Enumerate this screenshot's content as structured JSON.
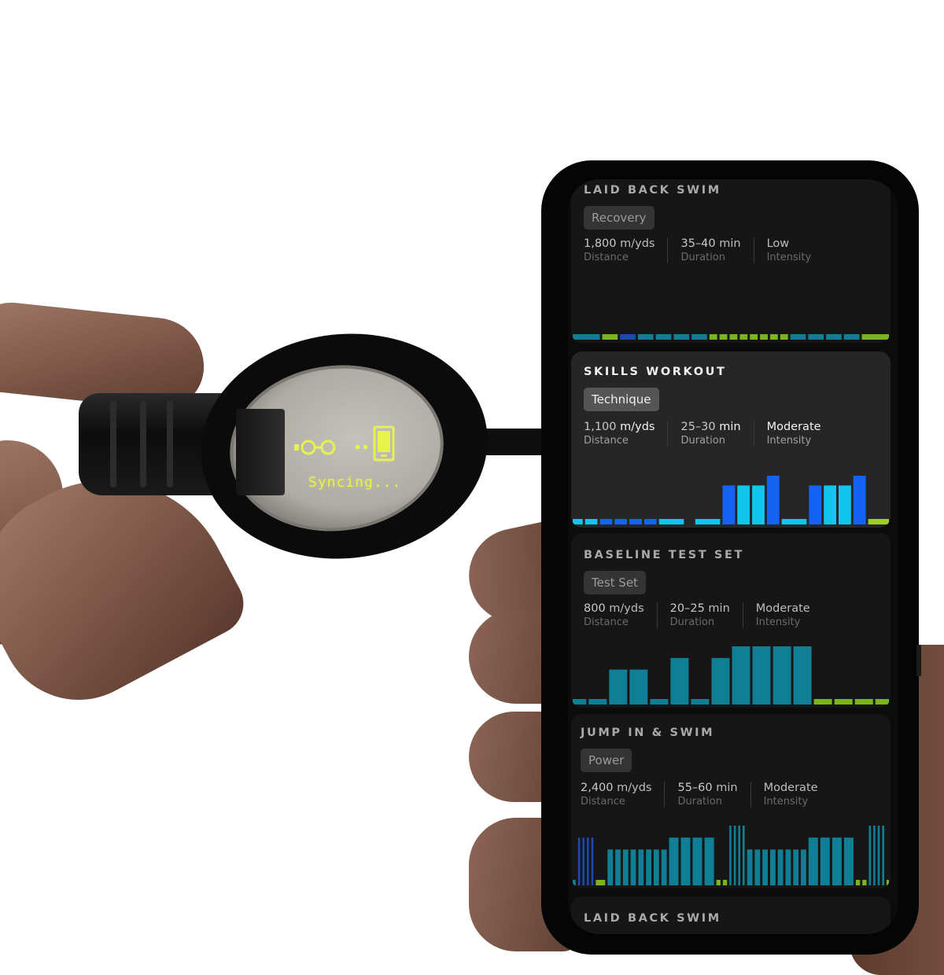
{
  "goggle": {
    "hud_status": "Syncing...",
    "hud_color": "#e8f24c"
  },
  "colors": {
    "teal": "#0f7f96",
    "blue_dark": "#1a49b3",
    "blue": "#1463f5",
    "cyan": "#10c6ec",
    "green": "#7ab51d",
    "green_bright": "#9ed11c"
  },
  "workouts": [
    {
      "title": "LAID BACK SWIM",
      "tag": "Recovery",
      "distance_value": "1,800",
      "distance_unit": "m/yds",
      "distance_label": "Distance",
      "duration_value": "35–40",
      "duration_unit": "min",
      "duration_label": "Duration",
      "intensity_value": "Low",
      "intensity_label": "Intensity",
      "selected": false,
      "chart_data": {
        "type": "bar",
        "description": "workout interval profile; width = relative duration, height = relative intensity level (1-5)",
        "segments": [
          {
            "w": 3.5,
            "h": 1,
            "c": "teal"
          },
          {
            "w": 2,
            "h": 1,
            "c": "green"
          },
          {
            "w": 2,
            "h": 1,
            "c": "blue_dark"
          },
          {
            "w": 2,
            "h": 1,
            "c": "teal"
          },
          {
            "w": 2,
            "h": 1,
            "c": "teal"
          },
          {
            "w": 2,
            "h": 1,
            "c": "teal"
          },
          {
            "w": 2,
            "h": 1,
            "c": "teal"
          },
          {
            "w": 1,
            "h": 1,
            "c": "green"
          },
          {
            "w": 1,
            "h": 1,
            "c": "green"
          },
          {
            "w": 1,
            "h": 1,
            "c": "green"
          },
          {
            "w": 1,
            "h": 1,
            "c": "green"
          },
          {
            "w": 1,
            "h": 1,
            "c": "green"
          },
          {
            "w": 1,
            "h": 1,
            "c": "green"
          },
          {
            "w": 1,
            "h": 1,
            "c": "green"
          },
          {
            "w": 1,
            "h": 1,
            "c": "green"
          },
          {
            "w": 2,
            "h": 1,
            "c": "teal"
          },
          {
            "w": 2,
            "h": 1,
            "c": "teal"
          },
          {
            "w": 2,
            "h": 1,
            "c": "teal"
          },
          {
            "w": 2,
            "h": 1,
            "c": "teal"
          },
          {
            "w": 3.5,
            "h": 1,
            "c": "green"
          }
        ]
      }
    },
    {
      "title": "SKILLS WORKOUT",
      "tag": "Technique",
      "distance_value": "1,100",
      "distance_unit": "m/yds",
      "distance_label": "Distance",
      "duration_value": "25–30",
      "duration_unit": "min",
      "duration_label": "Duration",
      "intensity_value": "Moderate",
      "intensity_label": "Intensity",
      "selected": true,
      "chart_data": {
        "type": "bar",
        "description": "workout interval profile; width = relative duration, height = relative intensity level (1-5)",
        "segments": [
          {
            "w": 1.2,
            "h": 1,
            "c": "cyan"
          },
          {
            "w": 1.5,
            "h": 1,
            "c": "cyan"
          },
          {
            "w": 1.5,
            "h": 1,
            "c": "blue"
          },
          {
            "w": 1.5,
            "h": 1,
            "c": "blue"
          },
          {
            "w": 1.5,
            "h": 1,
            "c": "blue"
          },
          {
            "w": 1.5,
            "h": 1,
            "c": "blue"
          },
          {
            "w": 3,
            "h": 1,
            "c": "cyan"
          },
          {
            "w": 0.8,
            "h": 0,
            "c": "cyan"
          },
          {
            "w": 3,
            "h": 1,
            "c": "cyan"
          },
          {
            "w": 1.5,
            "h": 4,
            "c": "blue"
          },
          {
            "w": 1.5,
            "h": 4,
            "c": "cyan"
          },
          {
            "w": 1.5,
            "h": 4,
            "c": "cyan"
          },
          {
            "w": 1.5,
            "h": 5,
            "c": "blue"
          },
          {
            "w": 3,
            "h": 1,
            "c": "cyan"
          },
          {
            "w": 1.5,
            "h": 4,
            "c": "blue"
          },
          {
            "w": 1.5,
            "h": 4,
            "c": "cyan"
          },
          {
            "w": 1.5,
            "h": 4,
            "c": "cyan"
          },
          {
            "w": 1.5,
            "h": 5,
            "c": "blue"
          },
          {
            "w": 2.5,
            "h": 1,
            "c": "green_bright"
          }
        ]
      }
    },
    {
      "title": "BASELINE TEST SET",
      "tag": "Test Set",
      "distance_value": "800",
      "distance_unit": "m/yds",
      "distance_label": "Distance",
      "duration_value": "20–25",
      "duration_unit": "min",
      "duration_label": "Duration",
      "intensity_value": "Moderate",
      "intensity_label": "Intensity",
      "selected": false,
      "chart_data": {
        "type": "bar",
        "description": "workout interval profile; width = relative duration, height = relative intensity level (1-5)",
        "segments": [
          {
            "w": 1.5,
            "h": 1,
            "c": "teal"
          },
          {
            "w": 2,
            "h": 1,
            "c": "teal"
          },
          {
            "w": 2,
            "h": 3,
            "c": "teal"
          },
          {
            "w": 2,
            "h": 3,
            "c": "teal"
          },
          {
            "w": 2,
            "h": 1,
            "c": "teal"
          },
          {
            "w": 2,
            "h": 4,
            "c": "teal"
          },
          {
            "w": 2,
            "h": 1,
            "c": "teal"
          },
          {
            "w": 2,
            "h": 4,
            "c": "teal"
          },
          {
            "w": 2,
            "h": 5,
            "c": "teal"
          },
          {
            "w": 2,
            "h": 5,
            "c": "teal"
          },
          {
            "w": 2,
            "h": 5,
            "c": "teal"
          },
          {
            "w": 2,
            "h": 5,
            "c": "teal"
          },
          {
            "w": 2,
            "h": 1,
            "c": "green"
          },
          {
            "w": 2,
            "h": 1,
            "c": "green"
          },
          {
            "w": 2,
            "h": 1,
            "c": "green"
          },
          {
            "w": 1.5,
            "h": 1,
            "c": "green"
          }
        ]
      }
    },
    {
      "title": "JUMP IN & SWIM",
      "tag": "Power",
      "distance_value": "2,400",
      "distance_unit": "m/yds",
      "distance_label": "Distance",
      "duration_value": "55–60",
      "duration_unit": "min",
      "duration_label": "Duration",
      "intensity_value": "Moderate",
      "intensity_label": "Intensity",
      "selected": false,
      "chart_data": {
        "type": "bar",
        "description": "workout interval profile; width = relative duration, height = relative intensity level (1-5)",
        "segments": [
          {
            "w": 0.5,
            "h": 1,
            "c": "teal"
          },
          {
            "w": 0.35,
            "h": 4,
            "c": "blue_dark"
          },
          {
            "w": 0.35,
            "h": 4,
            "c": "blue_dark"
          },
          {
            "w": 0.35,
            "h": 4,
            "c": "blue_dark"
          },
          {
            "w": 0.35,
            "h": 4,
            "c": "blue_dark"
          },
          {
            "w": 1.6,
            "h": 1,
            "c": "green"
          },
          {
            "w": 0.9,
            "h": 3,
            "c": "teal"
          },
          {
            "w": 0.9,
            "h": 3,
            "c": "teal"
          },
          {
            "w": 0.9,
            "h": 3,
            "c": "teal"
          },
          {
            "w": 0.9,
            "h": 3,
            "c": "teal"
          },
          {
            "w": 0.9,
            "h": 3,
            "c": "teal"
          },
          {
            "w": 0.9,
            "h": 3,
            "c": "teal"
          },
          {
            "w": 0.9,
            "h": 3,
            "c": "teal"
          },
          {
            "w": 0.9,
            "h": 3,
            "c": "teal"
          },
          {
            "w": 1.6,
            "h": 4,
            "c": "teal"
          },
          {
            "w": 1.6,
            "h": 4,
            "c": "teal"
          },
          {
            "w": 1.6,
            "h": 4,
            "c": "teal"
          },
          {
            "w": 1.6,
            "h": 4,
            "c": "teal"
          },
          {
            "w": 0.7,
            "h": 1,
            "c": "green"
          },
          {
            "w": 0.7,
            "h": 1,
            "c": "green"
          },
          {
            "w": 0.35,
            "h": 5,
            "c": "teal"
          },
          {
            "w": 0.35,
            "h": 5,
            "c": "teal"
          },
          {
            "w": 0.35,
            "h": 5,
            "c": "teal"
          },
          {
            "w": 0.35,
            "h": 5,
            "c": "teal"
          },
          {
            "w": 0.9,
            "h": 3,
            "c": "teal"
          },
          {
            "w": 0.9,
            "h": 3,
            "c": "teal"
          },
          {
            "w": 0.9,
            "h": 3,
            "c": "teal"
          },
          {
            "w": 0.9,
            "h": 3,
            "c": "teal"
          },
          {
            "w": 0.9,
            "h": 3,
            "c": "teal"
          },
          {
            "w": 0.9,
            "h": 3,
            "c": "teal"
          },
          {
            "w": 0.9,
            "h": 3,
            "c": "teal"
          },
          {
            "w": 0.9,
            "h": 3,
            "c": "teal"
          },
          {
            "w": 1.6,
            "h": 4,
            "c": "teal"
          },
          {
            "w": 1.6,
            "h": 4,
            "c": "teal"
          },
          {
            "w": 1.6,
            "h": 4,
            "c": "teal"
          },
          {
            "w": 1.6,
            "h": 4,
            "c": "teal"
          },
          {
            "w": 0.7,
            "h": 1,
            "c": "green"
          },
          {
            "w": 0.7,
            "h": 1,
            "c": "green"
          },
          {
            "w": 0.35,
            "h": 5,
            "c": "teal"
          },
          {
            "w": 0.35,
            "h": 5,
            "c": "teal"
          },
          {
            "w": 0.35,
            "h": 5,
            "c": "teal"
          },
          {
            "w": 0.35,
            "h": 5,
            "c": "teal"
          },
          {
            "w": 0.4,
            "h": 1,
            "c": "green"
          }
        ]
      }
    },
    {
      "title": "LAID BACK SWIM",
      "selected": false
    }
  ]
}
